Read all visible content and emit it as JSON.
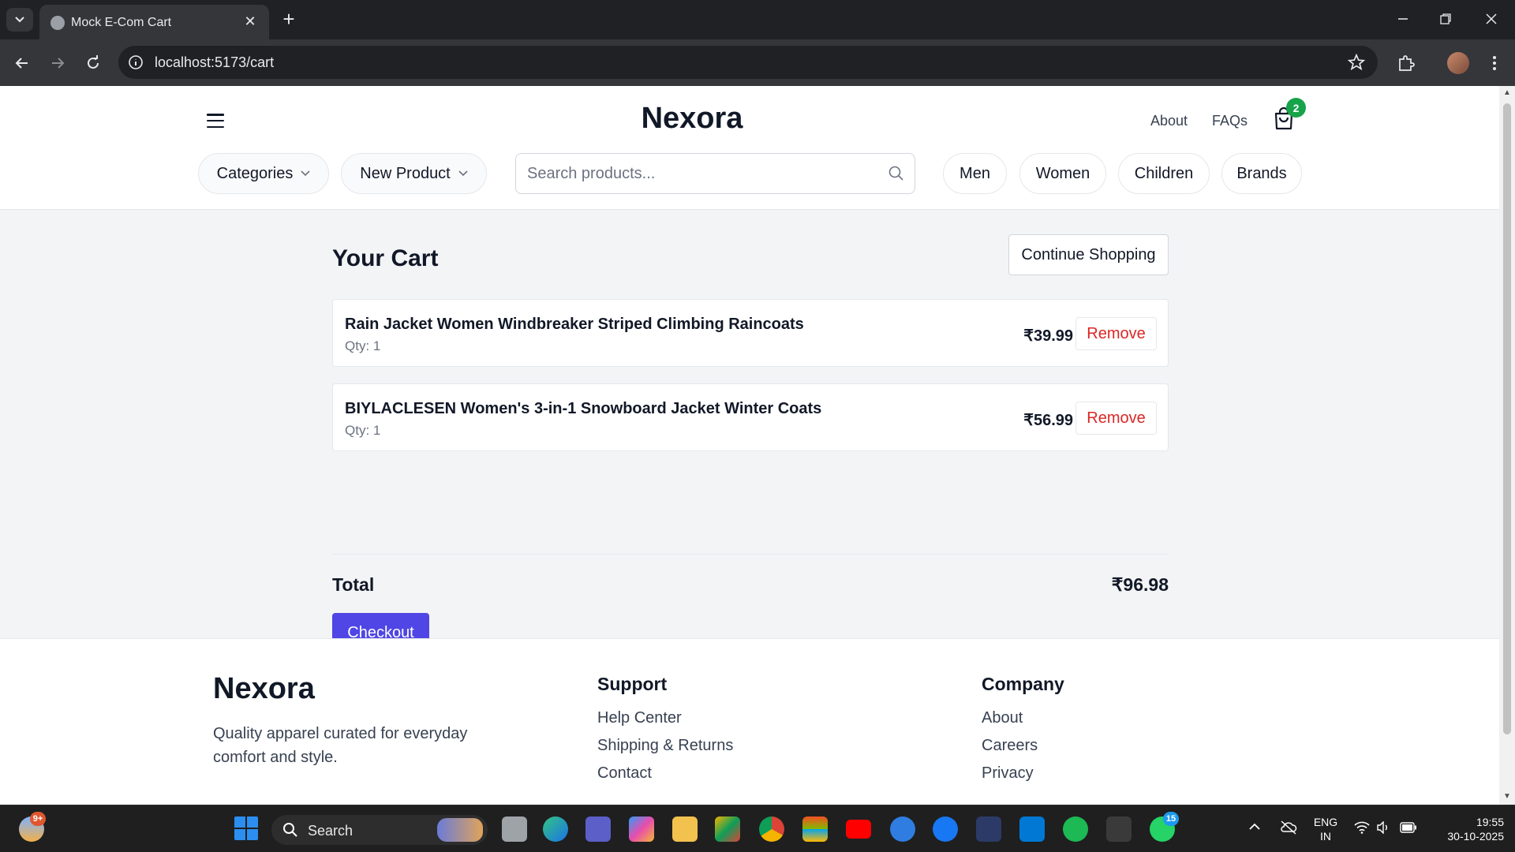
{
  "browser": {
    "tab_title": "Mock E-Com Cart",
    "url": "localhost:5173/cart"
  },
  "header": {
    "brand": "Nexora",
    "links": {
      "about": "About",
      "faqs": "FAQs"
    },
    "cart_count": "2",
    "categories_label": "Categories",
    "new_product_label": "New Product",
    "search_placeholder": "Search products...",
    "quick_filters": {
      "men": "Men",
      "women": "Women",
      "children": "Children",
      "brands": "Brands"
    }
  },
  "cart": {
    "title": "Your Cart",
    "continue_label": "Continue Shopping",
    "items": [
      {
        "name": "Rain Jacket Women Windbreaker Striped Climbing Raincoats",
        "qty": "Qty: 1",
        "price": "₹39.99",
        "remove_label": "Remove"
      },
      {
        "name": "BIYLACLESEN Women's 3-in-1 Snowboard Jacket Winter Coats",
        "qty": "Qty: 1",
        "price": "₹56.99",
        "remove_label": "Remove"
      }
    ],
    "total_label": "Total",
    "total_value": "₹96.98",
    "checkout_label": "Checkout"
  },
  "footer": {
    "brand": "Nexora",
    "tagline": "Quality apparel curated for everyday comfort and style.",
    "support": {
      "title": "Support",
      "links": [
        "Help Center",
        "Shipping & Returns",
        "Contact"
      ]
    },
    "company": {
      "title": "Company",
      "links": [
        "About",
        "Careers",
        "Privacy"
      ]
    }
  },
  "taskbar": {
    "search_label": "Search",
    "weather_badge": "9+",
    "whatsapp_badge": "15",
    "language": "ENG",
    "region": "IN",
    "time": "19:55",
    "date": "30-10-2025"
  },
  "colors": {
    "accent": "#4f46e5",
    "danger": "#dc2626",
    "badge": "#16a34a"
  }
}
